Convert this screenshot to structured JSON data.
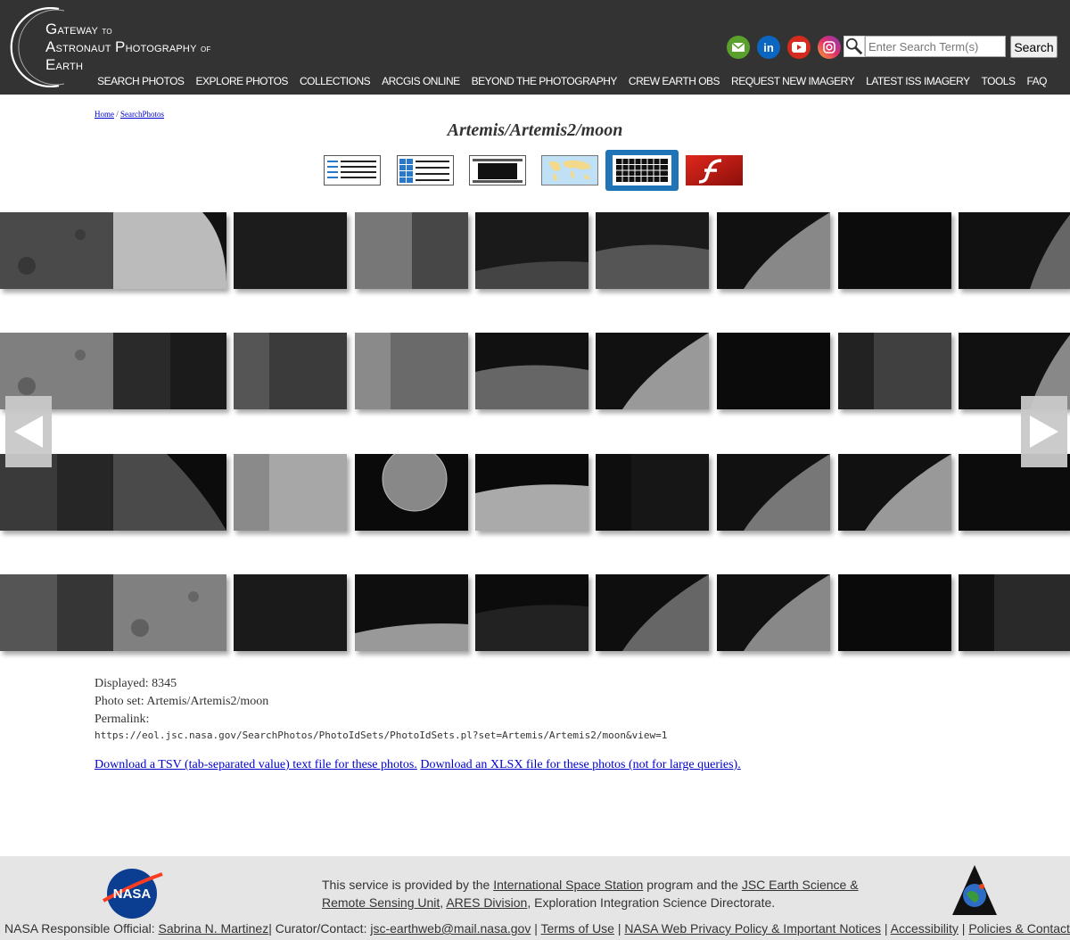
{
  "header": {
    "logo": {
      "line1_big": "G",
      "line1_rest": "ateway",
      "line1_small": "to",
      "line2_big": "A",
      "line2_rest": "stronaut",
      "line2_big2": "P",
      "line2_rest2": "hotography",
      "line2_small": "of",
      "line3_big": "E",
      "line3_rest": "arth"
    },
    "search_placeholder": "Enter Search Term(s)",
    "search_button": "Search",
    "nav": [
      "SEARCH PHOTOS",
      "EXPLORE PHOTOS",
      "COLLECTIONS",
      "ARCGIS ONLINE",
      "BEYOND THE PHOTOGRAPHY",
      "CREW EARTH OBS",
      "REQUEST NEW IMAGERY",
      "LATEST ISS IMAGERY",
      "TOOLS",
      "FAQ"
    ],
    "colors": {
      "bar": "#333333",
      "mail": "#5aa02c",
      "linkedin": "#0b66c2",
      "youtube": "#d42b1e"
    }
  },
  "breadcrumb": {
    "home": "Home",
    "sep": " / ",
    "search": "SearchPhotos"
  },
  "title": "Artemis/Artemis2/moon",
  "view_icons": [
    "list-view-icon",
    "detail-list-view-icon",
    "slideshow-view-icon",
    "map-view-icon",
    "thumbnail-grid-view-icon",
    "flash-view-icon"
  ],
  "active_view": "thumbnail-grid-view-icon",
  "info": {
    "displayed_label": "Displayed: ",
    "displayed_value": "8345",
    "photoset_label": "Photo set: ",
    "photoset_value": "Artemis/Artemis2/moon",
    "permalink_label": "Permalink:",
    "permalink_url": "https://eol.jsc.nasa.gov/SearchPhotos/PhotoIdSets/PhotoIdSets.pl?set=Artemis/Artemis2/moon&view=1"
  },
  "downloads": {
    "tsv": "Download a TSV (tab-separated value) text file for these photos.",
    "xlsx": "Download an XLSX file for these photos (not for large queries)."
  },
  "footer": {
    "provided_1": "This service is provided by the ",
    "iss": "International Space Station",
    "provided_2": " program and the ",
    "jsc": "JSC Earth Science & Remote Sensing Unit",
    "comma": ", ",
    "ares": "ARES Division",
    "provided_3": ", Exploration Integration Science Directorate.",
    "official_label": "NASA Responsible Official: ",
    "official": "Sabrina N. Martinez",
    "curator_label": "|  Curator/Contact: ",
    "curator": "jsc-earthweb@mail.nasa.gov",
    "sep": "  |  ",
    "terms": "Terms of Use",
    "privacy": "NASA Web Privacy Policy & Important Notices",
    "accessibility": "Accessibility",
    "policies": "Policies & Contacts",
    "nasa_logo_text": "NASA"
  }
}
